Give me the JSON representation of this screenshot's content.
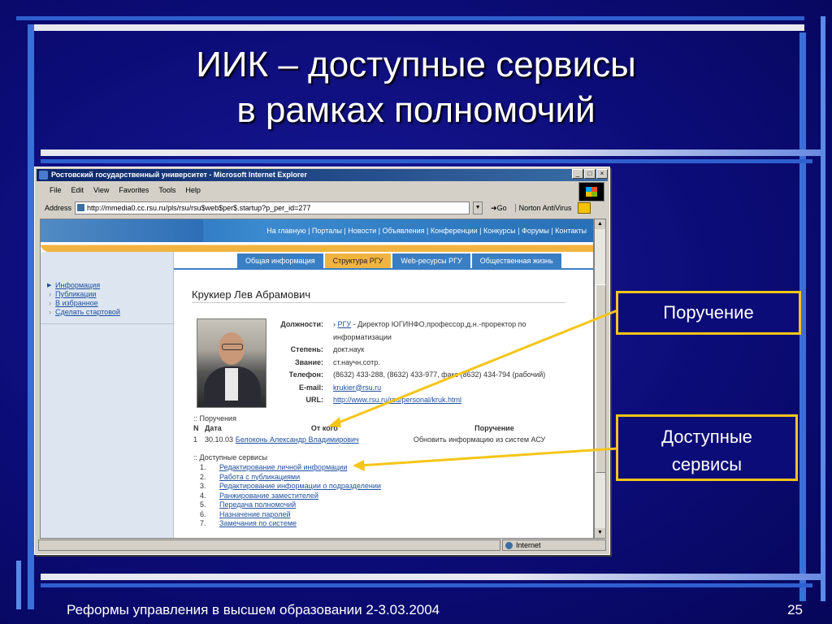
{
  "slide": {
    "title_line1": "ИИК – доступные сервисы",
    "title_line2": "в рамках полномочий",
    "footer": "Реформы управления в высшем образовании 2-3.03.2004",
    "page_number": "25"
  },
  "colors": {
    "background": "#0c0c78",
    "callout_border": "#f5c518",
    "stripe_light": "#3b6fd8"
  },
  "callouts": {
    "assignment": "Поручение",
    "services_line1": "Доступные",
    "services_line2": "сервисы"
  },
  "browser": {
    "window_title": "Ростовский государственный университет - Microsoft Internet Explorer",
    "menu": [
      "File",
      "Edit",
      "View",
      "Favorites",
      "Tools",
      "Help"
    ],
    "address_label": "Address",
    "address_value": "http://mmedia0.cc.rsu.ru/pls/rsu/rsu$web$per$.startup?p_per_id=277",
    "go_label": "Go",
    "toolbar_extra": "Norton AntiVirus",
    "status_zone": "Internet",
    "window_buttons": [
      "_",
      "□",
      "×"
    ]
  },
  "site": {
    "topnav": "На главную | Порталы | Новости | Объявления | Конференции | Конкурсы | Форумы | Контакты",
    "tabs": [
      "Общая информация",
      "Структура РГУ",
      "Web-ресурсы РГУ",
      "Общественная жизнь"
    ],
    "active_tab": "Структура РГУ",
    "sidebar_links": [
      "Информация",
      "Публикации",
      "В избранное",
      "Сделать стартовой"
    ]
  },
  "person": {
    "name": "Крукиер Лев Абрамович",
    "fields": [
      {
        "label": "Должности:",
        "value_prefix": "› ",
        "link": "РГУ",
        "value": " - Директор ЮГИНФО,профессор,д.н.-проректор по информатизации"
      },
      {
        "label": "Степень:",
        "value": "докт.наук"
      },
      {
        "label": "Звание:",
        "value": "ст.научн.сотр."
      },
      {
        "label": "Телефон:",
        "value": "(8632) 433-288, (8632) 433-977, факс (8632) 434-794 (рабочий)"
      },
      {
        "label": "E-mail:",
        "link": "krukier@rsu.ru"
      },
      {
        "label": "URL:",
        "link": "http://www.rsu.ru/rsu/personal/kruk.html"
      }
    ]
  },
  "assignments": {
    "section_title": ":: Поручения",
    "headers": [
      "N",
      "Дата",
      "От кого",
      "Поручение"
    ],
    "rows": [
      {
        "n": "1",
        "date": "30.10.03",
        "from": "Белоконь Александр Владимирович",
        "task": "Обновить информацию из систем АСУ"
      }
    ]
  },
  "services": {
    "section_title": ":: Доступные сервисы",
    "items": [
      {
        "n": "1.",
        "label": "Редактирование личной информации"
      },
      {
        "n": "2.",
        "label": "Работа с публикациями"
      },
      {
        "n": "3.",
        "label": "Редактирование информации о подразделении"
      },
      {
        "n": "4.",
        "label": "Ранжирование заместителей"
      },
      {
        "n": "5.",
        "label": "Передача полномочий"
      },
      {
        "n": "6.",
        "label": "Назначение паролей"
      },
      {
        "n": "7.",
        "label": "Замечания по системе"
      }
    ]
  }
}
